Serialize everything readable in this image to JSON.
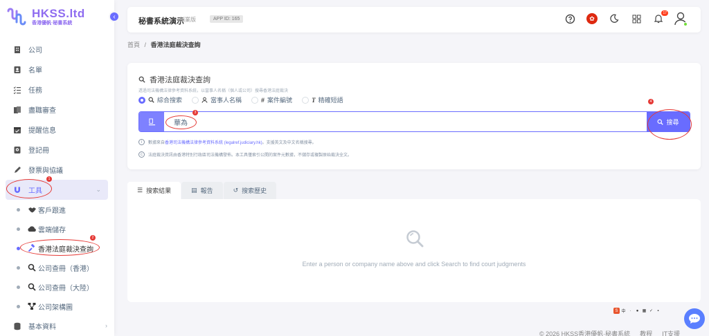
{
  "brand": {
    "name": "HKSS.ltd",
    "subtitle": "香港優帆·秘書系統"
  },
  "sidebar": {
    "items": [
      {
        "label": "公司",
        "icon": "building-icon"
      },
      {
        "label": "名單",
        "icon": "contacts-icon"
      },
      {
        "label": "任務",
        "icon": "checklist-icon"
      },
      {
        "label": "盡職審查",
        "icon": "documents-icon"
      },
      {
        "label": "提醒信息",
        "icon": "calendar-icon"
      },
      {
        "label": "登記冊",
        "icon": "register-icon"
      },
      {
        "label": "發票與協議",
        "icon": "pen-icon"
      }
    ],
    "tools": {
      "label": "工具",
      "icon": "magnet-icon",
      "mark": "1"
    },
    "tool_items": [
      {
        "label": "客戶跟進",
        "icon": "handshake-icon"
      },
      {
        "label": "雲端儲存",
        "icon": "cloud-icon"
      },
      {
        "label": "香港法庭裁決查詢",
        "icon": "gavel-icon",
        "mark": "2"
      },
      {
        "label": "公司查冊（香港）",
        "icon": "search-icon"
      },
      {
        "label": "公司查冊（大陸）",
        "icon": "search-icon"
      },
      {
        "label": "公司架構圖",
        "icon": "org-chart-icon"
      }
    ],
    "basic": {
      "label": "基本資料",
      "icon": "database-icon"
    }
  },
  "header": {
    "title": "秘書系統演示",
    "edition": "創業版",
    "app_id": "APP ID: 165",
    "notifications": "17"
  },
  "breadcrumb": {
    "home": "首頁",
    "separator": "/",
    "current": "香港法庭裁決查詢"
  },
  "search": {
    "title": "香港法庭裁決查詢",
    "description": "透過司法機構法律參考資料系統，以當事人名稱（個人或公司）搜尋香港法庭裁決",
    "modes": [
      "綜合搜索",
      "當事人名稱",
      "案件編號",
      "精確短語"
    ],
    "query": "華為",
    "query_mark": "3",
    "button": "搜尋",
    "button_mark": "4",
    "note1_prefix": "數據來自",
    "note1_link": "香港司法機構法律參考資料系統 (legalref.judiciary.hk)",
    "note1_suffix": "。支援英文及中文名稱搜尋。",
    "note2": "法庭裁決資訊由香港特別行政區司法機構發佈。本工具僅索引公開的案件元數據，不儲存或複製原始裁決全文。"
  },
  "tabs": [
    "搜索結果",
    "報告",
    "搜索歷史"
  ],
  "results": {
    "empty": "Enter a person or company name above and click Search to find court judgments"
  },
  "footer": {
    "copyright": "© 2026 HKSS香港優帆·秘書系統",
    "tutorial": "教程",
    "support": "IT支援"
  },
  "colors": {
    "primary": "#696cff",
    "brand": "#8f6cf0",
    "annotation": "#e53935"
  }
}
